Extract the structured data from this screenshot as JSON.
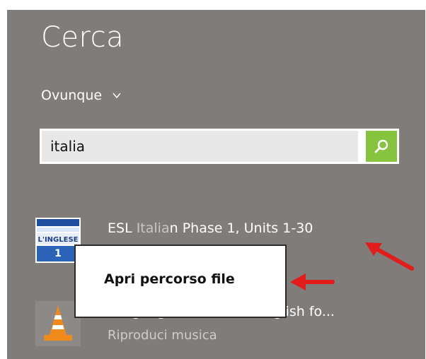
{
  "search_pane": {
    "title": "Cerca",
    "scope_label": "Ovunque",
    "query": "italia"
  },
  "results": [
    {
      "title_prefix": "ESL ",
      "title_match": "Italia",
      "title_suffix": "n Phase 1, Units 1-30",
      "thumb_text_top": "L'INGLESE",
      "thumb_text_num": "1"
    },
    {
      "title_visible": "Languages - Pimsleur English fo...",
      "subtitle": "Riproduci musica"
    }
  ],
  "context_menu": {
    "items": [
      "Apri percorso file"
    ]
  },
  "colors": {
    "pane_bg": "#7f7c79",
    "search_button": "#86c440",
    "annotation_arrow": "#e21b1b"
  },
  "icons": {
    "search_button": "magnifier-icon",
    "scope_dropdown": "chevron-down-icon",
    "result_2_thumb": "vlc-cone-icon"
  }
}
